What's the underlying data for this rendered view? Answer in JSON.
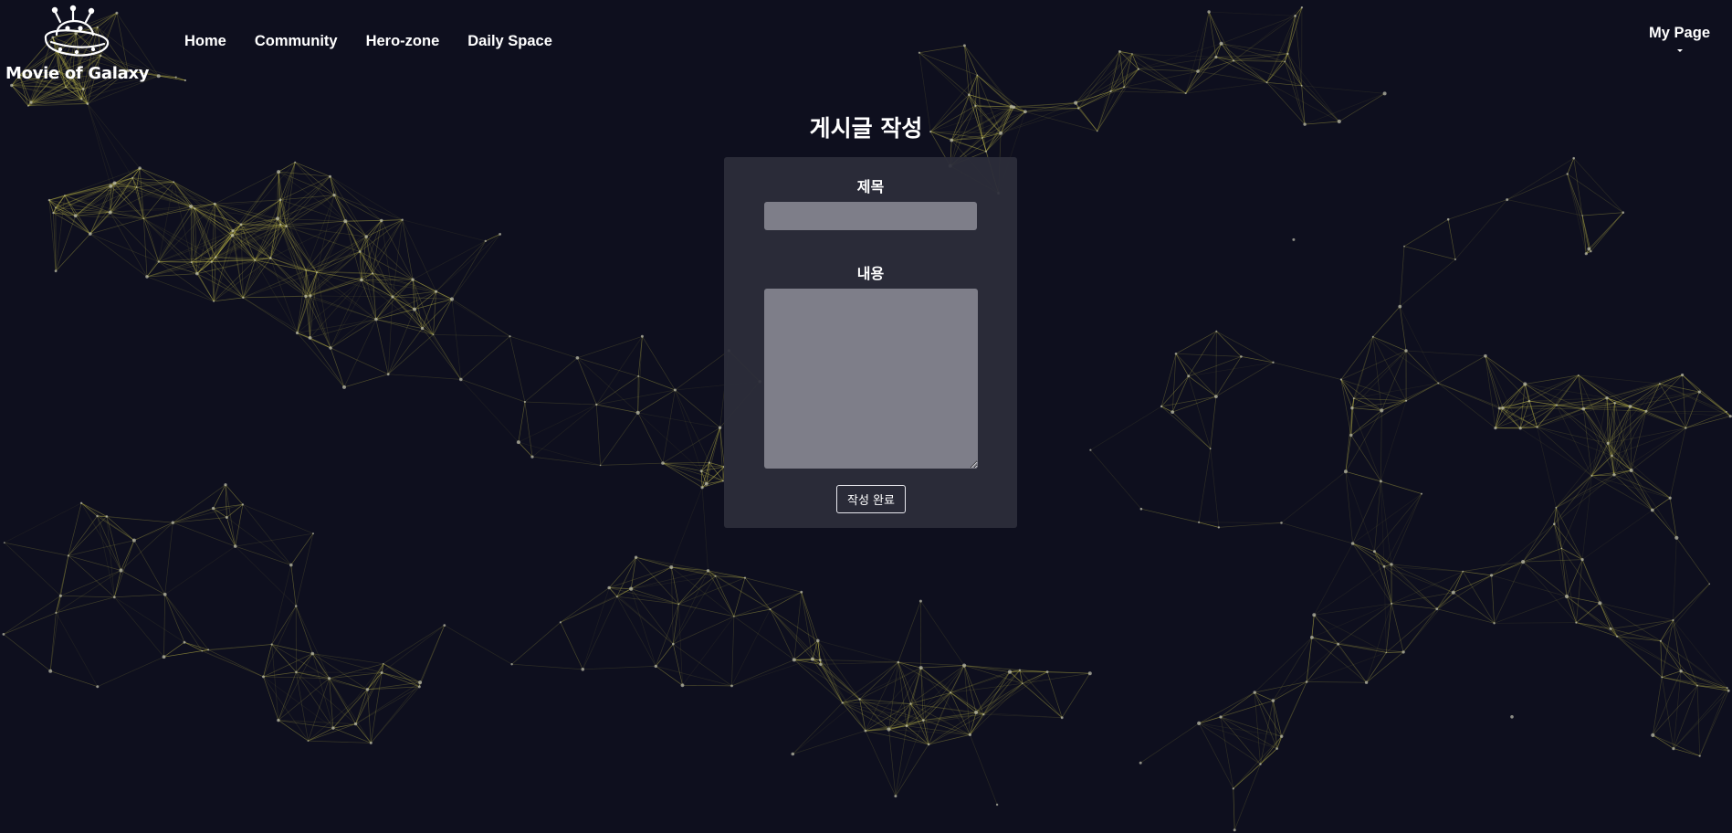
{
  "brand": {
    "name": "Movie of Galaxy",
    "icon": "ufo-alien-icon"
  },
  "nav": {
    "home": "Home",
    "community": "Community",
    "hero_zone": "Hero-zone",
    "daily_space": "Daily Space"
  },
  "user_menu": {
    "label": "My Page",
    "icon": "caret-down-icon"
  },
  "page": {
    "title": "게시글 작성"
  },
  "form": {
    "title_label": "제목",
    "title_value": "",
    "content_label": "내용",
    "content_value": "",
    "submit_label": "작성 완료"
  },
  "colors": {
    "background": "#0e0f1e",
    "network_lines": "#c9c24a",
    "network_nodes": "#b8b8a8",
    "card": "#2c2d3a",
    "input": "#96969f"
  }
}
